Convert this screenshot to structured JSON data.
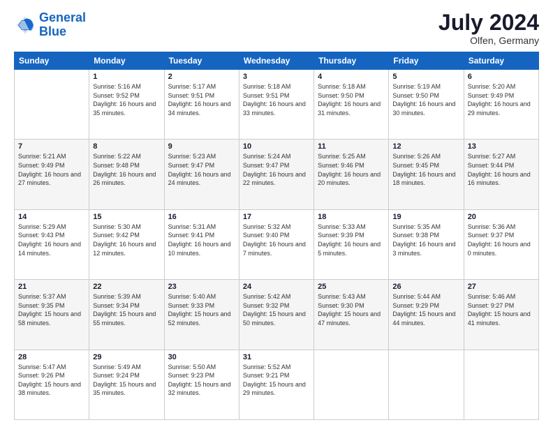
{
  "logo": {
    "line1": "General",
    "line2": "Blue"
  },
  "title": "July 2024",
  "location": "Olfen, Germany",
  "weekdays": [
    "Sunday",
    "Monday",
    "Tuesday",
    "Wednesday",
    "Thursday",
    "Friday",
    "Saturday"
  ],
  "weeks": [
    [
      {
        "day": "",
        "sunrise": "",
        "sunset": "",
        "daylight": ""
      },
      {
        "day": "1",
        "sunrise": "Sunrise: 5:16 AM",
        "sunset": "Sunset: 9:52 PM",
        "daylight": "Daylight: 16 hours and 35 minutes."
      },
      {
        "day": "2",
        "sunrise": "Sunrise: 5:17 AM",
        "sunset": "Sunset: 9:51 PM",
        "daylight": "Daylight: 16 hours and 34 minutes."
      },
      {
        "day": "3",
        "sunrise": "Sunrise: 5:18 AM",
        "sunset": "Sunset: 9:51 PM",
        "daylight": "Daylight: 16 hours and 33 minutes."
      },
      {
        "day": "4",
        "sunrise": "Sunrise: 5:18 AM",
        "sunset": "Sunset: 9:50 PM",
        "daylight": "Daylight: 16 hours and 31 minutes."
      },
      {
        "day": "5",
        "sunrise": "Sunrise: 5:19 AM",
        "sunset": "Sunset: 9:50 PM",
        "daylight": "Daylight: 16 hours and 30 minutes."
      },
      {
        "day": "6",
        "sunrise": "Sunrise: 5:20 AM",
        "sunset": "Sunset: 9:49 PM",
        "daylight": "Daylight: 16 hours and 29 minutes."
      }
    ],
    [
      {
        "day": "7",
        "sunrise": "Sunrise: 5:21 AM",
        "sunset": "Sunset: 9:49 PM",
        "daylight": "Daylight: 16 hours and 27 minutes."
      },
      {
        "day": "8",
        "sunrise": "Sunrise: 5:22 AM",
        "sunset": "Sunset: 9:48 PM",
        "daylight": "Daylight: 16 hours and 26 minutes."
      },
      {
        "day": "9",
        "sunrise": "Sunrise: 5:23 AM",
        "sunset": "Sunset: 9:47 PM",
        "daylight": "Daylight: 16 hours and 24 minutes."
      },
      {
        "day": "10",
        "sunrise": "Sunrise: 5:24 AM",
        "sunset": "Sunset: 9:47 PM",
        "daylight": "Daylight: 16 hours and 22 minutes."
      },
      {
        "day": "11",
        "sunrise": "Sunrise: 5:25 AM",
        "sunset": "Sunset: 9:46 PM",
        "daylight": "Daylight: 16 hours and 20 minutes."
      },
      {
        "day": "12",
        "sunrise": "Sunrise: 5:26 AM",
        "sunset": "Sunset: 9:45 PM",
        "daylight": "Daylight: 16 hours and 18 minutes."
      },
      {
        "day": "13",
        "sunrise": "Sunrise: 5:27 AM",
        "sunset": "Sunset: 9:44 PM",
        "daylight": "Daylight: 16 hours and 16 minutes."
      }
    ],
    [
      {
        "day": "14",
        "sunrise": "Sunrise: 5:29 AM",
        "sunset": "Sunset: 9:43 PM",
        "daylight": "Daylight: 16 hours and 14 minutes."
      },
      {
        "day": "15",
        "sunrise": "Sunrise: 5:30 AM",
        "sunset": "Sunset: 9:42 PM",
        "daylight": "Daylight: 16 hours and 12 minutes."
      },
      {
        "day": "16",
        "sunrise": "Sunrise: 5:31 AM",
        "sunset": "Sunset: 9:41 PM",
        "daylight": "Daylight: 16 hours and 10 minutes."
      },
      {
        "day": "17",
        "sunrise": "Sunrise: 5:32 AM",
        "sunset": "Sunset: 9:40 PM",
        "daylight": "Daylight: 16 hours and 7 minutes."
      },
      {
        "day": "18",
        "sunrise": "Sunrise: 5:33 AM",
        "sunset": "Sunset: 9:39 PM",
        "daylight": "Daylight: 16 hours and 5 minutes."
      },
      {
        "day": "19",
        "sunrise": "Sunrise: 5:35 AM",
        "sunset": "Sunset: 9:38 PM",
        "daylight": "Daylight: 16 hours and 3 minutes."
      },
      {
        "day": "20",
        "sunrise": "Sunrise: 5:36 AM",
        "sunset": "Sunset: 9:37 PM",
        "daylight": "Daylight: 16 hours and 0 minutes."
      }
    ],
    [
      {
        "day": "21",
        "sunrise": "Sunrise: 5:37 AM",
        "sunset": "Sunset: 9:35 PM",
        "daylight": "Daylight: 15 hours and 58 minutes."
      },
      {
        "day": "22",
        "sunrise": "Sunrise: 5:39 AM",
        "sunset": "Sunset: 9:34 PM",
        "daylight": "Daylight: 15 hours and 55 minutes."
      },
      {
        "day": "23",
        "sunrise": "Sunrise: 5:40 AM",
        "sunset": "Sunset: 9:33 PM",
        "daylight": "Daylight: 15 hours and 52 minutes."
      },
      {
        "day": "24",
        "sunrise": "Sunrise: 5:42 AM",
        "sunset": "Sunset: 9:32 PM",
        "daylight": "Daylight: 15 hours and 50 minutes."
      },
      {
        "day": "25",
        "sunrise": "Sunrise: 5:43 AM",
        "sunset": "Sunset: 9:30 PM",
        "daylight": "Daylight: 15 hours and 47 minutes."
      },
      {
        "day": "26",
        "sunrise": "Sunrise: 5:44 AM",
        "sunset": "Sunset: 9:29 PM",
        "daylight": "Daylight: 15 hours and 44 minutes."
      },
      {
        "day": "27",
        "sunrise": "Sunrise: 5:46 AM",
        "sunset": "Sunset: 9:27 PM",
        "daylight": "Daylight: 15 hours and 41 minutes."
      }
    ],
    [
      {
        "day": "28",
        "sunrise": "Sunrise: 5:47 AM",
        "sunset": "Sunset: 9:26 PM",
        "daylight": "Daylight: 15 hours and 38 minutes."
      },
      {
        "day": "29",
        "sunrise": "Sunrise: 5:49 AM",
        "sunset": "Sunset: 9:24 PM",
        "daylight": "Daylight: 15 hours and 35 minutes."
      },
      {
        "day": "30",
        "sunrise": "Sunrise: 5:50 AM",
        "sunset": "Sunset: 9:23 PM",
        "daylight": "Daylight: 15 hours and 32 minutes."
      },
      {
        "day": "31",
        "sunrise": "Sunrise: 5:52 AM",
        "sunset": "Sunset: 9:21 PM",
        "daylight": "Daylight: 15 hours and 29 minutes."
      },
      {
        "day": "",
        "sunrise": "",
        "sunset": "",
        "daylight": ""
      },
      {
        "day": "",
        "sunrise": "",
        "sunset": "",
        "daylight": ""
      },
      {
        "day": "",
        "sunrise": "",
        "sunset": "",
        "daylight": ""
      }
    ]
  ]
}
